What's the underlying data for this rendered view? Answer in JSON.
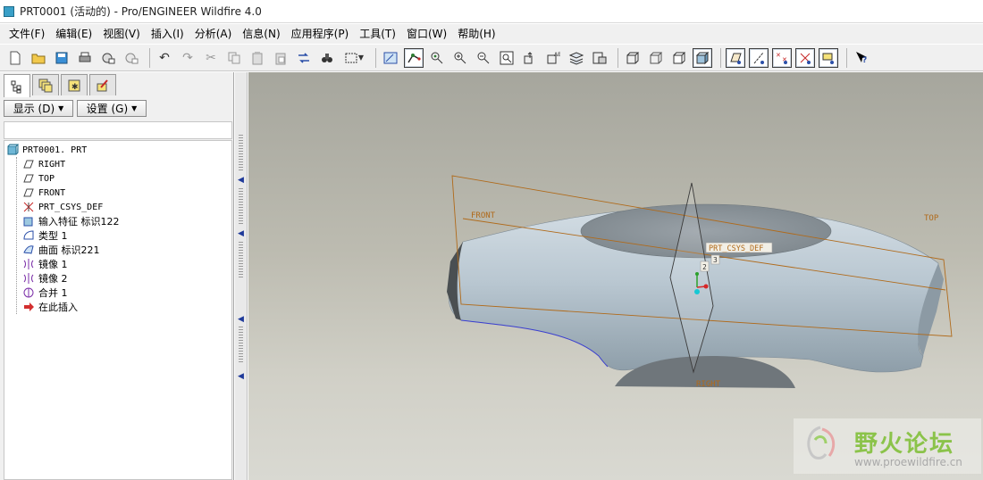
{
  "window": {
    "title": "PRT0001 (活动的) - Pro/ENGINEER Wildfire 4.0"
  },
  "menu": [
    {
      "label": "文件(F)"
    },
    {
      "label": "编辑(E)"
    },
    {
      "label": "视图(V)"
    },
    {
      "label": "插入(I)"
    },
    {
      "label": "分析(A)"
    },
    {
      "label": "信息(N)"
    },
    {
      "label": "应用程序(P)"
    },
    {
      "label": "工具(T)"
    },
    {
      "label": "窗口(W)"
    },
    {
      "label": "帮助(H)"
    }
  ],
  "toolbar": {
    "icons": [
      "new-icon",
      "open-icon",
      "save-icon",
      "print-icon",
      "email-icon",
      "email-link-icon",
      "undo-icon",
      "redo-icon",
      "cut-icon",
      "copy-icon",
      "paste-icon",
      "paste-special-icon",
      "regenerate-icon",
      "find-icon",
      "select-box-icon",
      "repaint-icon",
      "spin-center-icon",
      "orient-mode-icon",
      "zoom-in-icon",
      "zoom-out-icon",
      "refit-icon",
      "reorient-icon",
      "saved-views-icon",
      "layers-icon",
      "view-manager-icon",
      "wireframe-icon",
      "hidden-line-icon",
      "no-hidden-icon",
      "shading-icon",
      "datum-planes-icon",
      "datum-axes-icon",
      "datum-points-icon",
      "csys-icon",
      "annotations-icon",
      "whats-this-icon"
    ]
  },
  "left_panel": {
    "tabs": [
      "model-tree-tab",
      "layers-tab",
      "favorites-tab",
      "tools-tab"
    ],
    "show_button": "显示 (D)",
    "settings_button": "设置 (G)"
  },
  "model_tree": {
    "root": "PRT0001. PRT",
    "items": [
      {
        "label": "RIGHT",
        "icon": "datum-plane-icon",
        "mono": true
      },
      {
        "label": "TOP",
        "icon": "datum-plane-icon",
        "mono": true
      },
      {
        "label": "FRONT",
        "icon": "datum-plane-icon",
        "mono": true
      },
      {
        "label": "PRT_CSYS_DEF",
        "icon": "csys-icon",
        "mono": true
      },
      {
        "label": "输入特征 标识122",
        "icon": "import-feature-icon",
        "mono": false
      },
      {
        "label": "类型 1",
        "icon": "style-feature-icon",
        "mono": false
      },
      {
        "label": "曲面 标识221",
        "icon": "surface-icon",
        "mono": false
      },
      {
        "label": "镜像 1",
        "icon": "mirror-icon",
        "mono": false
      },
      {
        "label": "镜像 2",
        "icon": "mirror-icon",
        "mono": false
      },
      {
        "label": "合并 1",
        "icon": "merge-icon",
        "mono": false
      },
      {
        "label": "在此插入",
        "icon": "insert-here-arrow-icon",
        "mono": false
      }
    ]
  },
  "viewport": {
    "datum_labels": {
      "front": "FRONT",
      "top": "TOP",
      "right": "RIGHT",
      "csys": "PRT_CSYS_DEF",
      "axis_2": "2",
      "axis_3": "3"
    },
    "colors": {
      "datum": "#b06a1a",
      "model": "#b3c2cc",
      "background_top": "#a6a69d",
      "background_bottom": "#d9d9d2"
    }
  },
  "watermark": {
    "text": "野火论坛",
    "url": "www.proewildfire.cn"
  }
}
